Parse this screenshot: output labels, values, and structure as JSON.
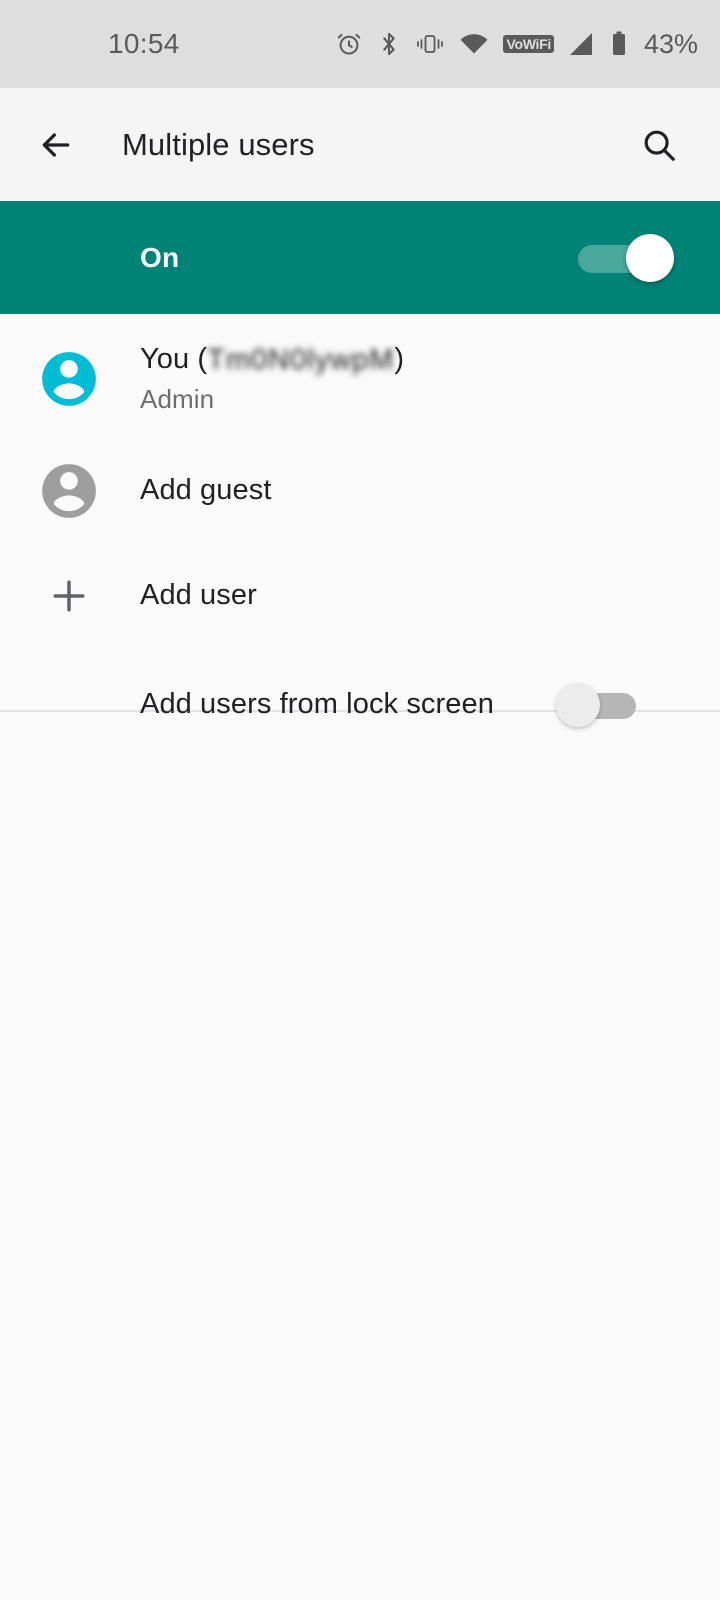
{
  "status_bar": {
    "time": "10:54",
    "battery_percent": "43%",
    "vowifi_label": "VoWiFi",
    "icons": [
      "alarm-icon",
      "bluetooth-icon",
      "vibrate-icon",
      "wifi-icon",
      "vowifi-badge",
      "cellular-signal-icon",
      "battery-icon"
    ]
  },
  "app_bar": {
    "back_icon": "back-arrow-icon",
    "title": "Multiple users",
    "search_icon": "search-icon"
  },
  "master_switch": {
    "label": "On",
    "state": "on",
    "accent_color": "#008275",
    "track_color": "#4aa79c",
    "thumb_color": "#ffffff"
  },
  "users": [
    {
      "icon": "account-circle-icon",
      "icon_color": "#00bcd4",
      "title_prefix": "You (",
      "title_redacted": "Tm0N0lywpM",
      "title_suffix": ")",
      "subtitle": "Admin"
    },
    {
      "icon": "account-circle-icon",
      "icon_color": "#9e9e9e",
      "title": "Add guest"
    },
    {
      "icon": "plus-icon",
      "icon_color": "#5f6368",
      "title": "Add user"
    }
  ],
  "settings": {
    "add_users_from_lock_screen": {
      "label": "Add users from lock screen",
      "state": "off",
      "track_color": "#b6b6b6",
      "thumb_color": "#ececec"
    }
  }
}
